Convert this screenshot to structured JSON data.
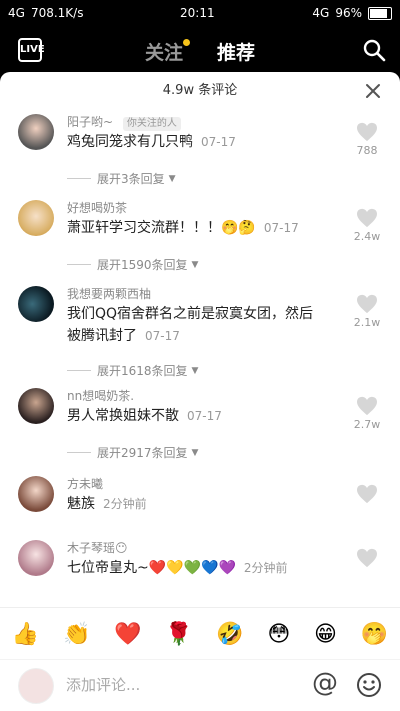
{
  "status_bar": {
    "left": "4G",
    "speed": "708.1K/s",
    "time": "20:11",
    "right_net": "4G",
    "battery": "96%"
  },
  "nav": {
    "live_label": "LIVE",
    "follow_tab": "关注",
    "recommend_tab": "推荐"
  },
  "panel": {
    "title": "4.9w 条评论"
  },
  "comments": [
    {
      "name": "阳子哟~",
      "tag": "你关注的人",
      "text": "鸡兔同笼求有几只鸭",
      "date": "07-17",
      "likes": "788",
      "expand": "展开3条回复"
    },
    {
      "name": "好想喝奶茶",
      "tag": "",
      "text": "萧亚轩学习交流群！！！🤭🤔",
      "date": "07-17",
      "likes": "2.4w",
      "expand": "展开1590条回复"
    },
    {
      "name": "我想要两颗西柚",
      "tag": "",
      "text": "我们QQ宿舍群名之前是寂寞女团，然后被腾讯封了",
      "date": "07-17",
      "likes": "2.1w",
      "expand": "展开1618条回复"
    },
    {
      "name": "nn想喝奶茶.",
      "tag": "",
      "text": "男人常换姐妹不散",
      "date": "07-17",
      "likes": "2.7w",
      "expand": "展开2917条回复"
    },
    {
      "name": "方未曦",
      "tag": "",
      "text": "魅族",
      "date": "2分钟前",
      "likes": "",
      "expand": ""
    },
    {
      "name": "木子琴瑶😶",
      "tag": "",
      "text": "七位帝皇丸~❤️💛💚💙💜",
      "date": "2分钟前",
      "likes": "",
      "expand": ""
    }
  ],
  "emojis": [
    "👍",
    "👏",
    "❤️",
    "🌹",
    "🤣",
    "😳",
    "😁",
    "🤭"
  ],
  "input": {
    "placeholder": "添加评论..."
  },
  "colors": {
    "background": "#000000",
    "panel": "#ffffff",
    "follow_dot": "#f6c31a"
  }
}
